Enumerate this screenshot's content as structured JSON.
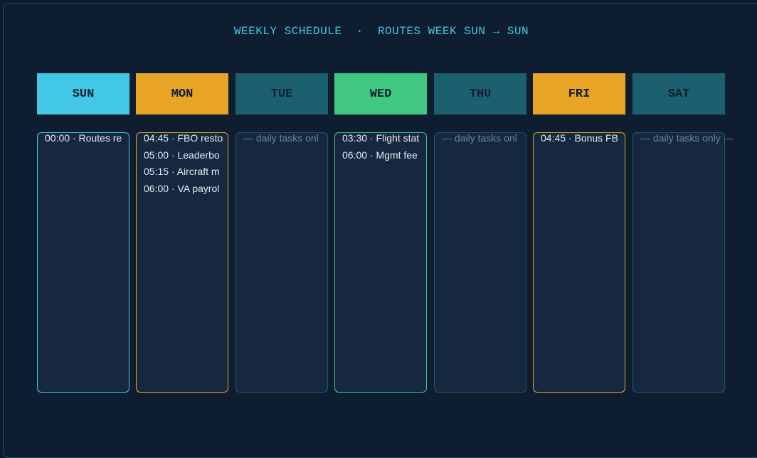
{
  "header": {
    "title": "WEEKLY SCHEDULE  ·  ROUTES WEEK SUN → SUN"
  },
  "colors": {
    "sun": "#42c8e4",
    "mon": "#e8a424",
    "tue": "#1c6070",
    "wed": "#40c882",
    "thu": "#1c6070",
    "fri": "#e8a424",
    "sat": "#1c6070"
  },
  "days": [
    {
      "label": "SUN",
      "tasks": [
        "00:00 · Routes re"
      ]
    },
    {
      "label": "MON",
      "tasks": [
        "04:45 · FBO resto",
        "05:00 · Leaderbo",
        "05:15 · Aircraft m",
        "06:00 · VA payrol"
      ]
    },
    {
      "label": "TUE",
      "note": "— daily tasks onl"
    },
    {
      "label": "WED",
      "tasks": [
        "03:30 · Flight stat",
        "06:00 · Mgmt fee"
      ]
    },
    {
      "label": "THU",
      "note": "— daily tasks onl"
    },
    {
      "label": "FRI",
      "tasks": [
        "04:45 · Bonus FB"
      ]
    },
    {
      "label": "SAT",
      "note": "— daily tasks only —"
    }
  ]
}
